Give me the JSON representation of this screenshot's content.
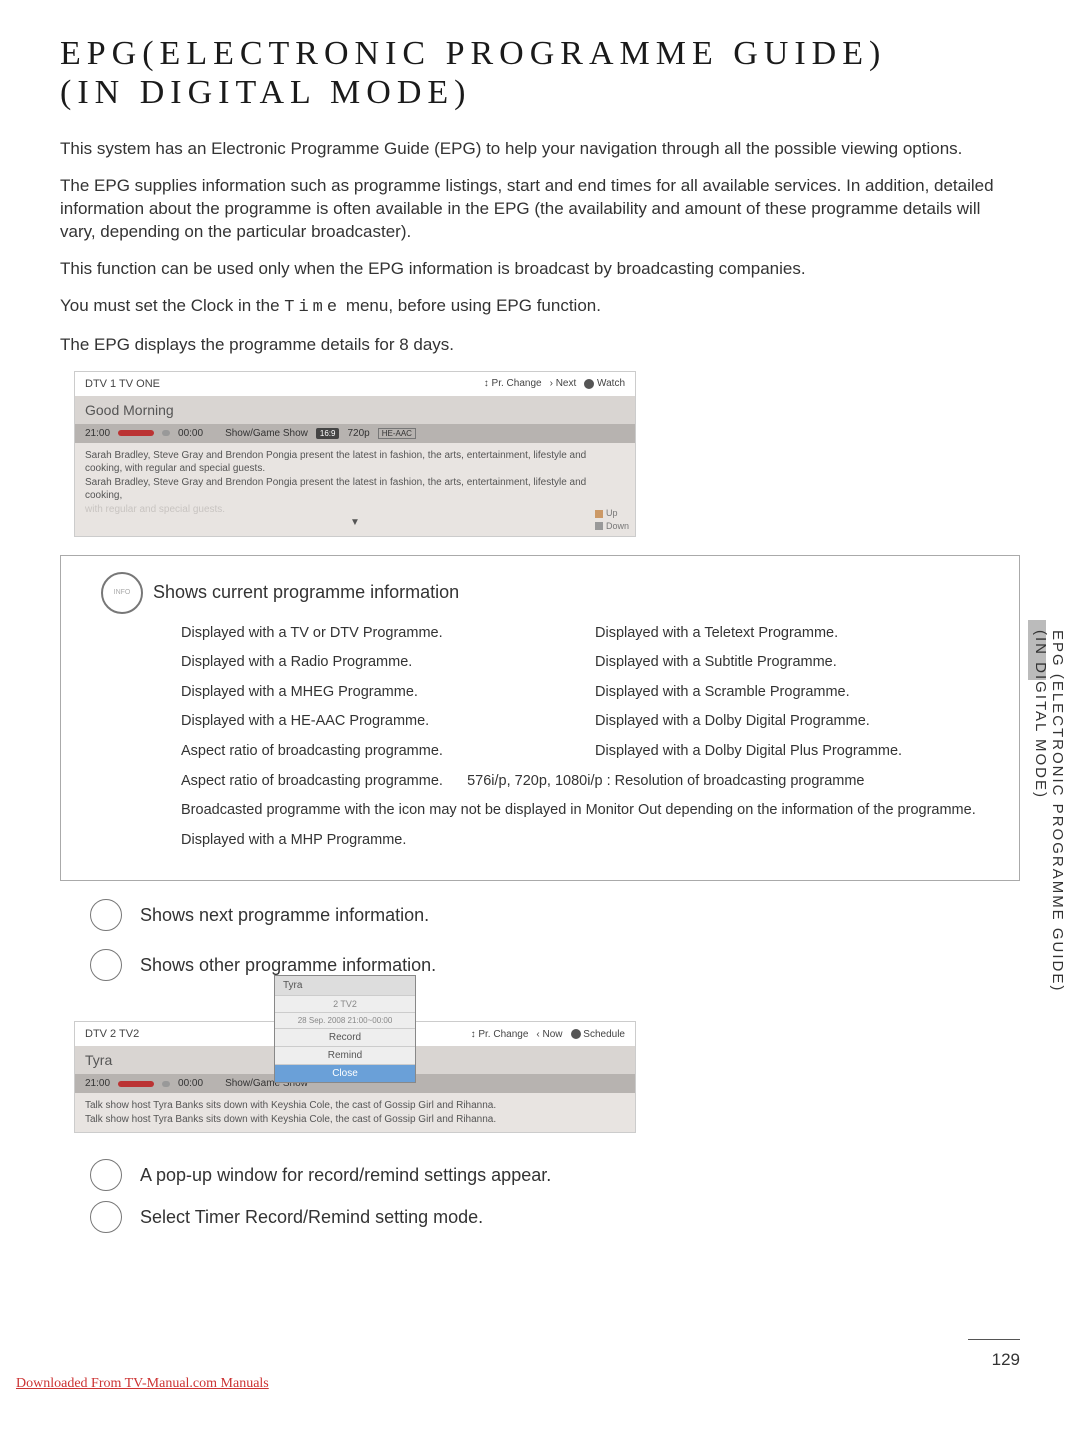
{
  "title_line1": "EPG(ELECTRONIC PROGRAMME GUIDE)",
  "title_line2": "(IN DIGITAL MODE)",
  "intro": {
    "p1": "This system has an Electronic Programme Guide (EPG) to help your navigation through all the possible viewing options.",
    "p2": "The EPG supplies information such as programme listings, start and end times for all available services. In addition, detailed information about the programme is often available in the EPG (the availability and amount of these programme details will vary, depending on the particular broadcaster).",
    "p3": "This function can be used only when the EPG information is broadcast by broadcasting companies.",
    "p4_a": "You must set the Clock in the ",
    "p4_time": "Time",
    "p4_b": " menu, before using EPG function.",
    "p5": "The EPG displays the programme details for 8 days."
  },
  "epg1": {
    "channel": "DTV 1  TV ONE",
    "pr_change": "Pr. Change",
    "next": "Next",
    "watch": "Watch",
    "prog_title": "Good Morning",
    "t1": "21:00",
    "t2": "00:00",
    "genre": "Show/Game Show",
    "badge1": "16:9",
    "badge2": "720p",
    "badge3": "HE-AAC",
    "desc1": "Sarah Bradley, Steve Gray and Brendon Pongia present the latest in fashion, the arts, entertainment, lifestyle and cooking, with regular and special guests.",
    "desc2": "Sarah Bradley, Steve Gray and Brendon Pongia present the latest in fashion, the arts, entertainment, lifestyle and cooking,",
    "desc_ghost": "with regular and special guests.",
    "arrow": "▼",
    "up": "Up",
    "down": "Down"
  },
  "info": {
    "heading": "Shows current programme information",
    "left": [
      "Displayed with a TV or DTV Programme.",
      "Displayed with a Radio Programme.",
      "Displayed with a MHEG Programme.",
      "Displayed with a HE-AAC Programme.",
      "Aspect ratio of broadcasting programme.",
      "Aspect ratio of broadcasting programme."
    ],
    "right": [
      "Displayed with a Teletext Programme.",
      "Displayed with a Subtitle Programme.",
      "Displayed with a Scramble Programme.",
      "Displayed with a Dolby Digital Programme.",
      "Displayed with a Dolby Digital Plus Programme.",
      "576i/p, 720p, 1080i/p : Resolution of broadcasting programme"
    ],
    "full1": "Broadcasted programme with the icon may not be displayed in Monitor Out depending on the information of the programme.",
    "full2": "Displayed with a MHP Programme."
  },
  "sect_next": "Shows next programme information.",
  "sect_other": "Shows other programme information.",
  "popup": {
    "title": "Tyra",
    "sub1": "2 TV2",
    "sub2": "28 Sep. 2008 21:00~00:00",
    "record": "Record",
    "remind": "Remind",
    "close": "Close"
  },
  "epg2": {
    "channel": "DTV 2  TV2",
    "pr_change": "Pr. Change",
    "now": "Now",
    "schedule": "Schedule",
    "prog_title": "Tyra",
    "t1": "21:00",
    "t2": "00:00",
    "genre": "Show/Game Show",
    "desc1": "Talk show host Tyra Banks sits down with Keyshia Cole, the cast of Gossip Girl and Rihanna.",
    "desc2": "Talk show host Tyra Banks sits down with Keyshia Cole, the cast of Gossip Girl and Rihanna."
  },
  "sect_popup": "A pop-up window for record/remind settings appear.",
  "sect_timer": "Select Timer Record/Remind setting mode.",
  "side_a": "EPG (ELECTRONIC PROGRAMME GUIDE)",
  "side_b": "(IN DIGITAL MODE)",
  "page_number": "129",
  "footer": "Downloaded From TV-Manual.com Manuals"
}
